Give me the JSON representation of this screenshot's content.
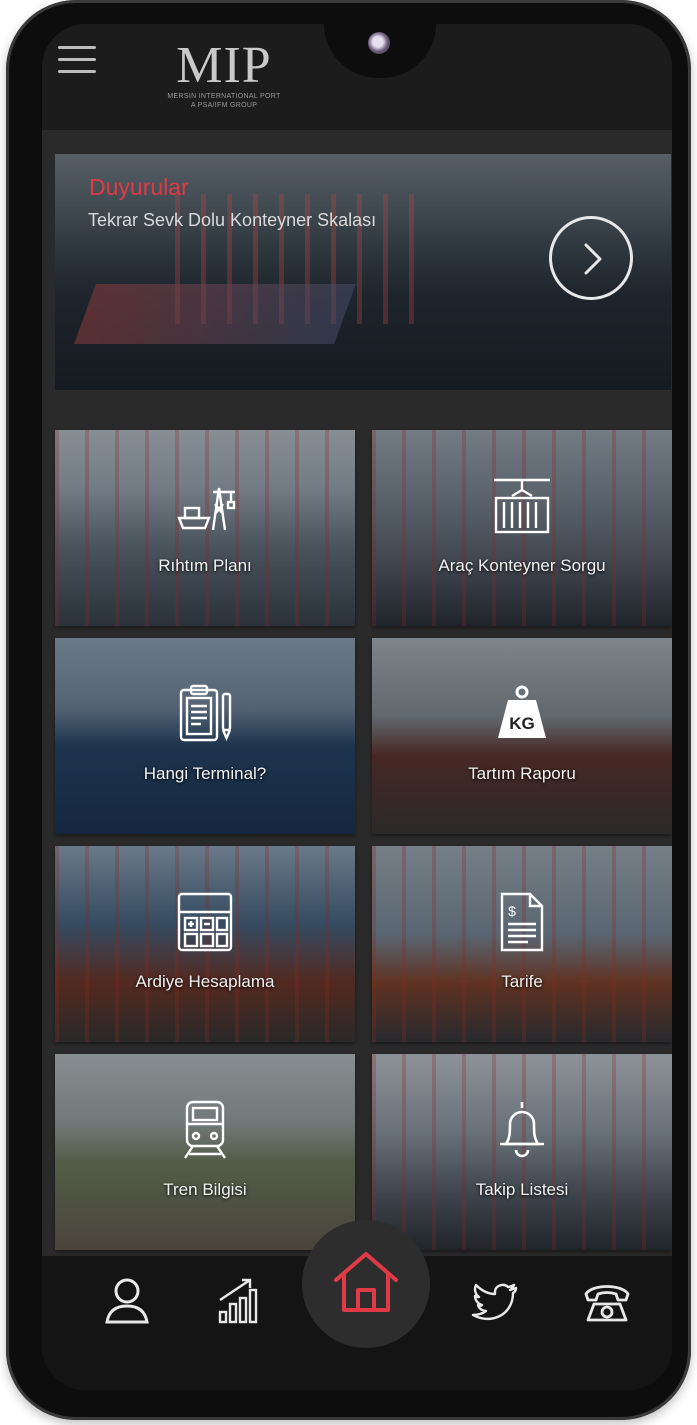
{
  "brand": {
    "logo_text": "MIP",
    "logo_subtitle": "MERSIN INTERNATIONAL PORT",
    "logo_tagline": "A PSA/IFM GROUP"
  },
  "colors": {
    "accent": "#e03a47",
    "background": "#2a2a2a",
    "topbar": "#1c1c1c",
    "bottombar": "#141414"
  },
  "header": {
    "menu_icon": "hamburger-menu-icon"
  },
  "banner": {
    "title": "Duyurular",
    "text": "Tekrar Sevk Dolu Konteyner Skalası",
    "arrow_icon": "chevron-right-circle-icon"
  },
  "tiles": [
    {
      "label": "Rıhtım Planı",
      "icon": "ship-crane-icon"
    },
    {
      "label": "Araç Konteyner Sorgu",
      "icon": "container-crane-icon"
    },
    {
      "label": "Hangi Terminal?",
      "icon": "clipboard-pen-icon"
    },
    {
      "label": "Tartım Raporu",
      "icon": "kg-weight-icon"
    },
    {
      "label": "Ardiye Hesaplama",
      "icon": "calculator-icon"
    },
    {
      "label": "Tarife",
      "icon": "dollar-document-icon"
    },
    {
      "label": "Tren Bilgisi",
      "icon": "train-icon"
    },
    {
      "label": "Takip Listesi",
      "icon": "bell-icon"
    }
  ],
  "bottom_nav": [
    {
      "icon": "user-icon"
    },
    {
      "icon": "growth-chart-icon"
    },
    {
      "icon": "home-icon"
    },
    {
      "icon": "twitter-icon"
    },
    {
      "icon": "telephone-icon"
    }
  ]
}
